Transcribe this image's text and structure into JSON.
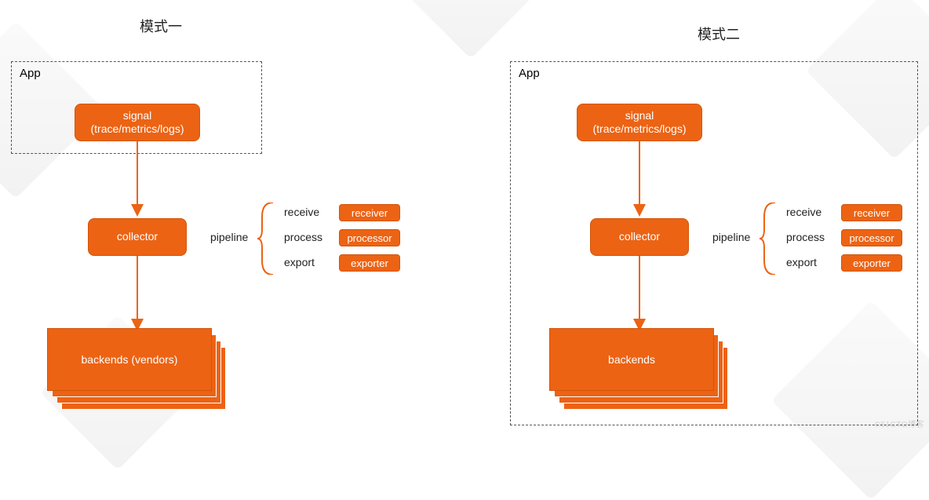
{
  "titles": {
    "mode1": "模式一",
    "mode2": "模式二"
  },
  "app_label": "App",
  "nodes": {
    "signal": "signal\n(trace/metrics/logs)",
    "collector": "collector",
    "backends_vendors": "backends (vendors)",
    "backends": "backends"
  },
  "pipeline": {
    "label": "pipeline",
    "stages": {
      "receive": "receive",
      "process": "process",
      "export": "export"
    },
    "tags": {
      "receiver": "receiver",
      "processor": "processor",
      "exporter": "exporter"
    }
  },
  "colors": {
    "accent": "#ec6314"
  },
  "watermark": "©51CTO博客"
}
